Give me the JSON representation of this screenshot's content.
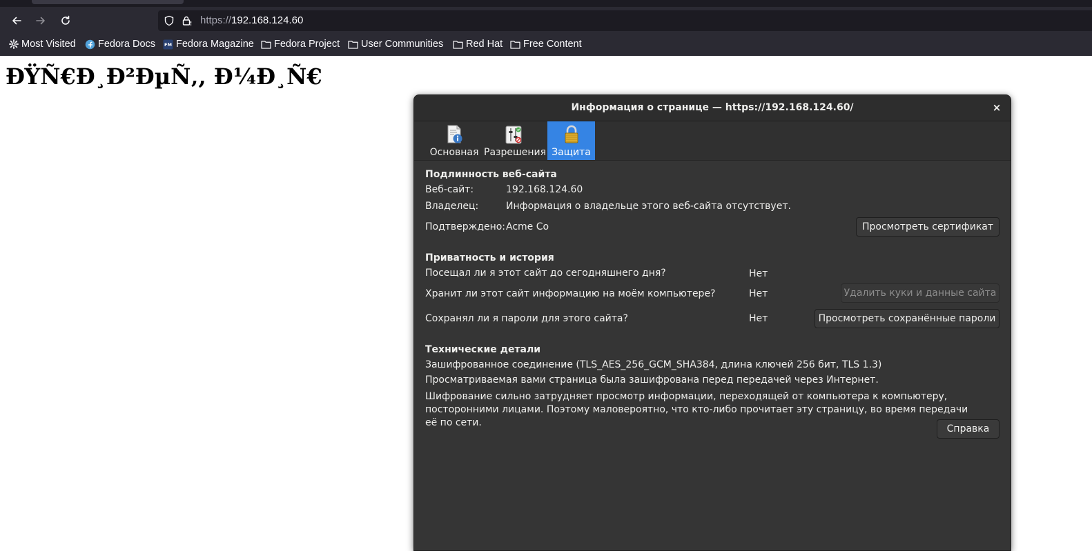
{
  "browser": {
    "url_scheme": "https://",
    "url_host": "192.168.124.60",
    "bookmarks": [
      {
        "label": "Most Visited",
        "icon": "gear-icon"
      },
      {
        "label": "Fedora Docs",
        "icon": "fedora-icon"
      },
      {
        "label": "Fedora Magazine",
        "icon": "fm-icon"
      },
      {
        "label": "Fedora Project",
        "icon": "folder-icon"
      },
      {
        "label": "User Communities",
        "icon": "folder-icon"
      },
      {
        "label": "Red Hat",
        "icon": "folder-icon"
      },
      {
        "label": "Free Content",
        "icon": "folder-icon"
      }
    ]
  },
  "page": {
    "heading": "ÐŸÑ€Ð¸Ð²ÐµÑ‚, Ð¼Ð¸Ñ€"
  },
  "dialog": {
    "title": "Информация о странице — https://192.168.124.60/",
    "close": "×",
    "tabs": [
      {
        "label": "Основная",
        "icon": "info-icon",
        "active": false
      },
      {
        "label": "Разрешения",
        "icon": "permissions-icon",
        "active": false
      },
      {
        "label": "Защита",
        "icon": "padlock-icon",
        "active": true
      }
    ],
    "identity": {
      "header": "Подлинность веб-сайта",
      "website_label": "Веб-сайт:",
      "website_value": "192.168.124.60",
      "owner_label": "Владелец:",
      "owner_value": "Информация о владельце этого веб-сайта отсутствует.",
      "verified_label": "Подтверждено:",
      "verified_value": "Acme Co",
      "view_cert_button": "Просмотреть сертификат"
    },
    "privacy": {
      "header": "Приватность и история",
      "visited_q": "Посещал ли я этот сайт до сегодняшнего дня?",
      "visited_a": "Нет",
      "stores_q": "Хранит ли этот сайт информацию на моём компьютере?",
      "stores_a": "Нет",
      "clear_button": "Удалить куки и данные сайта",
      "passwords_q": "Сохранял ли я пароли для этого сайта?",
      "passwords_a": "Нет",
      "view_passwords_button": "Просмотреть сохранённые пароли"
    },
    "technical": {
      "header": "Технические детали",
      "line1": "Зашифрованное соединение (TLS_AES_256_GCM_SHA384, длина ключей 256 бит, TLS 1.3)",
      "line2": "Просматриваемая вами страница была зашифрована перед передачей через Интернет.",
      "line3": "Шифрование сильно затрудняет просмотр информации, переходящей от компьютера к компьютеру, посторонними лицами. Поэтому маловероятно, что кто-либо прочитает эту страницу, во время передачи её по сети.",
      "help_button": "Справка"
    }
  },
  "colors": {
    "chrome_bg": "#2b2a33",
    "dialog_bg": "#353535",
    "accent": "#3584e4"
  }
}
